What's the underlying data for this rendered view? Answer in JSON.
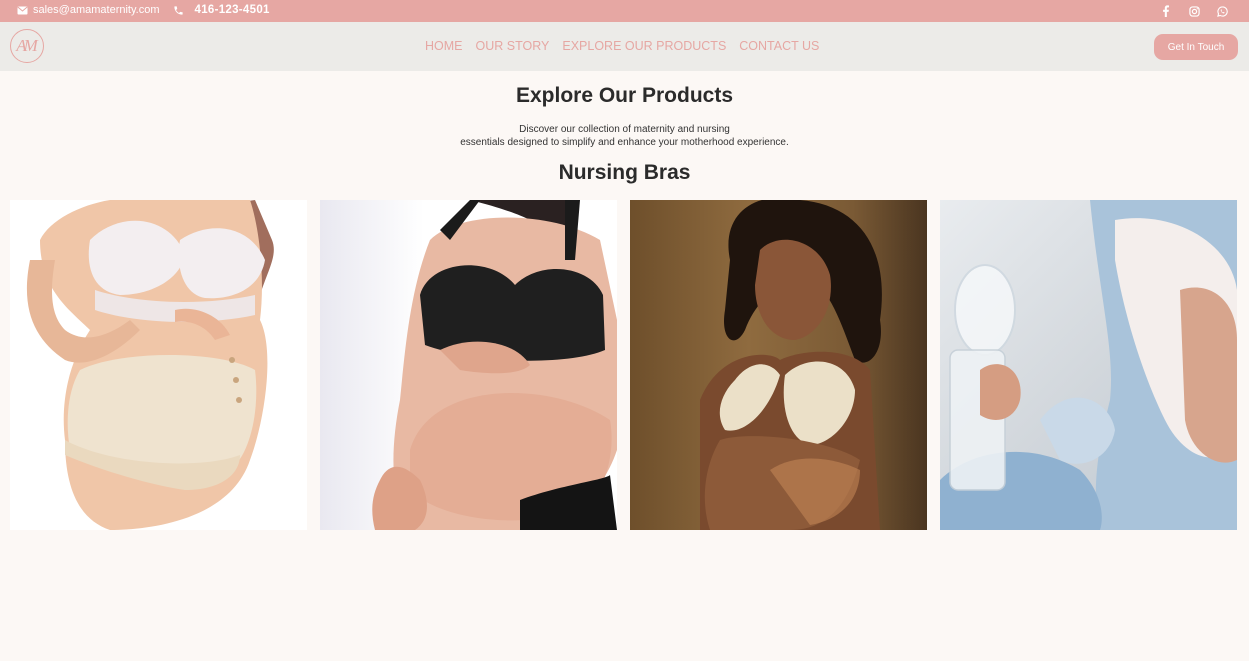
{
  "topbar": {
    "email": "sales@amamaternity.com",
    "phone": "416-123-4501",
    "social_icons": [
      "facebook-icon",
      "instagram-icon",
      "whatsapp-icon"
    ]
  },
  "header": {
    "logo_text": "AM",
    "nav": [
      "HOME",
      "OUR STORY",
      "EXPLORE OUR PRODUCTS",
      "CONTACT US"
    ],
    "cta": "Get In Touch"
  },
  "main": {
    "title": "Explore Our Products",
    "intro_line1": "Discover our collection of maternity and nursing",
    "intro_line2": "essentials designed to simplify and enhance your motherhood experience.",
    "section_title": "Nursing Bras"
  },
  "colors": {
    "accent": "#e6a7a3",
    "header_bg": "#ecebe8",
    "page_bg": "#fcf8f5",
    "text": "#2b2b2b"
  }
}
